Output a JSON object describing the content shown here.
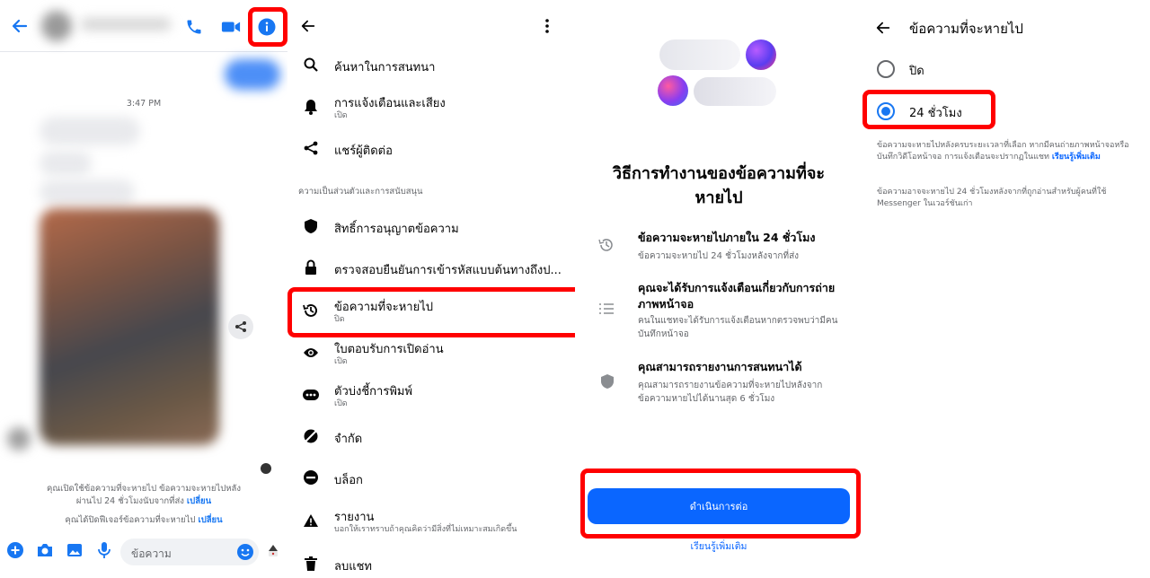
{
  "panel1": {
    "timestamp": "3:47 PM",
    "notice_line1": "คุณเปิดใช้ข้อความที่จะหายไป ข้อความจะหายไปหลัง",
    "notice_line2": "ผ่านไป 24 ชั่วโมงนับจากที่ส่ง",
    "notice_change1": "เปลี่ยน",
    "notice2": "คุณได้ปิดฟีเจอร์ข้อความที่จะหายไป",
    "notice_change2": "เปลี่ยน",
    "composer_placeholder": "ข้อความ",
    "accent": "#1877f2"
  },
  "panel2": {
    "section_label": "ความเป็นส่วนตัวและการสนับสนุน",
    "items": [
      {
        "label": "ค้นหาในการสนทนา",
        "sub": "",
        "icon": "search-icon"
      },
      {
        "label": "การแจ้งเตือนและเสียง",
        "sub": "เปิด",
        "icon": "bell-icon"
      },
      {
        "label": "แชร์ผู้ติดต่อ",
        "sub": "",
        "icon": "share-icon"
      },
      {
        "label": "สิทธิ์การอนุญาตข้อความ",
        "sub": "",
        "icon": "shield-icon"
      },
      {
        "label": "ตรวจสอบยืนยันการเข้ารหัสแบบต้นทางถึงป...",
        "sub": "",
        "icon": "lock-icon"
      },
      {
        "label": "ข้อความที่จะหายไป",
        "sub": "ปิด",
        "icon": "timer-history-icon"
      },
      {
        "label": "ใบตอบรับการเปิดอ่าน",
        "sub": "เปิด",
        "icon": "eye-icon"
      },
      {
        "label": "ตัวบ่งชี้การพิมพ์",
        "sub": "เปิด",
        "icon": "typing-icon"
      },
      {
        "label": "จำกัด",
        "sub": "",
        "icon": "restrict-icon"
      },
      {
        "label": "บล็อก",
        "sub": "",
        "icon": "block-icon"
      },
      {
        "label": "รายงาน",
        "sub": "บอกให้เราทราบถ้าคุณคิดว่ามีสิ่งที่ไม่เหมาะสมเกิดขึ้น",
        "icon": "warning-icon"
      },
      {
        "label": "ลบแชท",
        "sub": "",
        "icon": "trash-icon"
      }
    ]
  },
  "panel3": {
    "title": "วิธีการทำงานของข้อความที่จะหายไป",
    "features": [
      {
        "title": "ข้อความจะหายไปภายใน 24 ชั่วโมง",
        "desc": "ข้อความจะหายไป 24 ชั่วโมงหลังจากที่ส่ง"
      },
      {
        "title": "คุณจะได้รับการแจ้งเตือนเกี่ยวกับการถ่ายภาพหน้าจอ",
        "desc": "คนในแชทจะได้รับการแจ้งเตือนหากตรวจพบว่ามีคนบันทึกหน้าจอ"
      },
      {
        "title": "คุณสามารถรายงานการสนทนาได้",
        "desc": "คุณสามารถรายงานข้อความที่จะหายไปหลังจากข้อความหายไปได้นานสุด 6 ชั่วโมง"
      }
    ],
    "continue_label": "ดำเนินการต่อ",
    "learn_more": "เรียนรู้เพิ่มเติม"
  },
  "panel4": {
    "title": "ข้อความที่จะหายไป",
    "options": [
      {
        "label": "ปิด",
        "selected": false
      },
      {
        "label": "24 ชั่วโมง",
        "selected": true
      }
    ],
    "desc1": "ข้อความจะหายไปหลังครบระยะเวลาที่เลือก หากมีคนถ่ายภาพหน้าจอหรือบันทึกวิดีโอหน้าจอ การแจ้งเตือนจะปรากฏในแชท",
    "desc1_link": "เรียนรู้เพิ่มเติม",
    "desc2": "ข้อความอาจจะหายไป 24 ชั่วโมงหลังจากที่ถูกอ่านสำหรับผู้คนที่ใช้ Messenger ในเวอร์ชันเก่า"
  }
}
